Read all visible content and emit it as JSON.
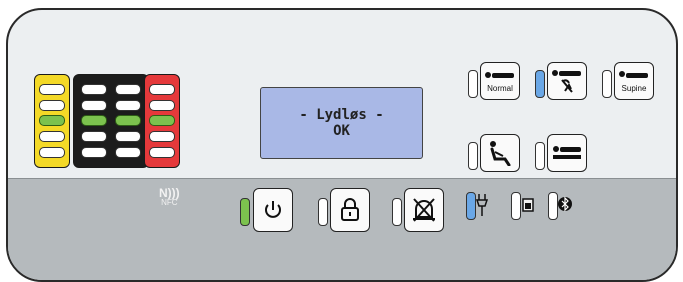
{
  "display": {
    "line1": "- Lydløs -",
    "line2": "OK"
  },
  "buttons": {
    "normal": {
      "label": "Normal"
    },
    "supine": {
      "label": "Supine"
    }
  },
  "nfc": {
    "label": "NFC"
  },
  "colors": {
    "panel": "#eceff1",
    "bottom": "#b5babd",
    "lcd": "#a9b8e6",
    "indicator_green": "#7cc24e",
    "indicator_blue": "#6aa7e6",
    "bar_yellow": "#f4d927",
    "bar_black": "#1c1c1c",
    "bar_red": "#e5393b"
  },
  "level_bars": {
    "yellow_lit_index": 2,
    "black_left_lit_index": 2,
    "black_right_lit_index": 2,
    "red_lit_index": 2
  },
  "icons": [
    "normal-position-icon",
    "turn-disabled-icon",
    "supine-position-icon",
    "sitting-position-icon",
    "flat-bed-icon",
    "power-icon",
    "lock-icon",
    "alarm-mute-icon",
    "plug-icon",
    "battery-icon",
    "bluetooth-icon",
    "nfc-icon"
  ]
}
